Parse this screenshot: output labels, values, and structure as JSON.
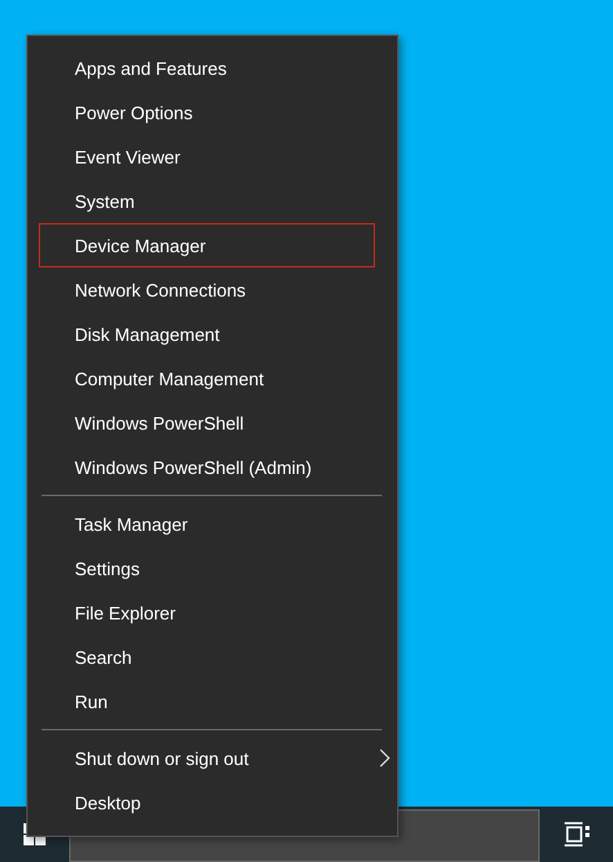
{
  "menu": {
    "groups": [
      {
        "items": [
          {
            "label": "Apps and Features",
            "selected": false,
            "kind": "command"
          },
          {
            "label": "Power Options",
            "selected": false,
            "kind": "command"
          },
          {
            "label": "Event Viewer",
            "selected": false,
            "kind": "command"
          },
          {
            "label": "System",
            "selected": false,
            "kind": "command"
          },
          {
            "label": "Device Manager",
            "selected": true,
            "kind": "command"
          },
          {
            "label": "Network Connections",
            "selected": false,
            "kind": "command"
          },
          {
            "label": "Disk Management",
            "selected": false,
            "kind": "command"
          },
          {
            "label": "Computer Management",
            "selected": false,
            "kind": "command"
          },
          {
            "label": "Windows PowerShell",
            "selected": false,
            "kind": "command"
          },
          {
            "label": "Windows PowerShell (Admin)",
            "selected": false,
            "kind": "command"
          }
        ]
      },
      {
        "items": [
          {
            "label": "Task Manager",
            "selected": false,
            "kind": "command"
          },
          {
            "label": "Settings",
            "selected": false,
            "kind": "command"
          },
          {
            "label": "File Explorer",
            "selected": false,
            "kind": "command"
          },
          {
            "label": "Search",
            "selected": false,
            "kind": "command"
          },
          {
            "label": "Run",
            "selected": false,
            "kind": "command"
          }
        ]
      },
      {
        "items": [
          {
            "label": "Shut down or sign out",
            "selected": false,
            "kind": "submenu"
          },
          {
            "label": "Desktop",
            "selected": false,
            "kind": "command"
          }
        ]
      }
    ]
  }
}
